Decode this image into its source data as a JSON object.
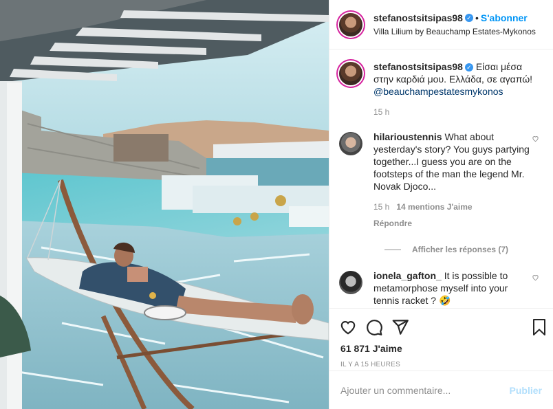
{
  "header": {
    "username": "stefanostsitsipas98",
    "verified_symbol": "✓",
    "separator": "•",
    "follow_label": "S'abonner",
    "location": "Villa Lilium by Beauchamp Estates-Mykonos"
  },
  "caption": {
    "username": "stefanostsitsipas98",
    "text": "Είσαι μέσα στην καρδιά μου. Ελλάδα, σε αγαπώ!",
    "mention": "@beauchampestatesmykonos",
    "time": "15 h"
  },
  "comments": [
    {
      "username": "hilarioustennis",
      "text": "What about yesterday's story? You guys partying together...I guess you are on the footsteps of the man the legend Mr. Novak Djoco...",
      "time": "15 h",
      "likes": "14 mentions J'aime",
      "reply_label": "Répondre"
    },
    {
      "username": "ionela_gafton_",
      "text": "It is possible to metamorphose myself into your tennis racket ? 🤣"
    }
  ],
  "view_replies_label": "Afficher les réponses (7)",
  "likes_count": "61 871 J'aime",
  "timestamp": "IL Y A 15 HEURES",
  "add_comment": {
    "placeholder": "Ajouter un commentaire...",
    "publish_label": "Publier"
  },
  "colors": {
    "accent": "#0095f6",
    "publish_disabled": "#b2dffc",
    "muted": "#8e8e8e",
    "text": "#262626"
  },
  "icons": [
    "heart-icon",
    "comment-icon",
    "share-icon",
    "bookmark-icon",
    "verified-badge-icon"
  ]
}
